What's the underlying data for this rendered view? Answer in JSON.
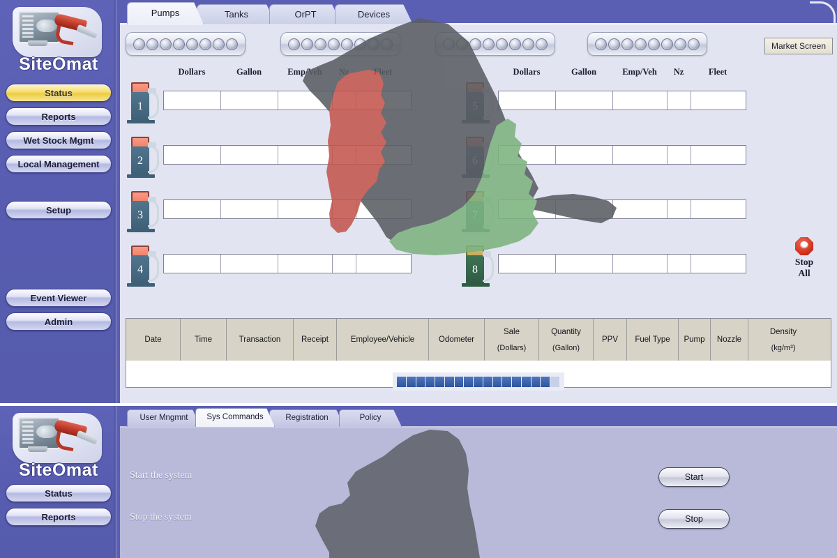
{
  "app": {
    "brand": "SiteOmat"
  },
  "top_panel": {
    "tabs": [
      {
        "label": "Pumps",
        "active": true
      },
      {
        "label": "Tanks",
        "active": false
      },
      {
        "label": "OrPT",
        "active": false
      },
      {
        "label": "Devices",
        "active": false
      }
    ],
    "indicator_groups": 4,
    "dots_per_group": 8,
    "market_screen_button": "Market Screen",
    "stop_all": {
      "line1": "Stop",
      "line2": "All",
      "icon": "stop-octagon-icon",
      "color": "#d0311c"
    },
    "pump_column_headers": [
      "Dollars",
      "Gallon",
      "Emp/Veh",
      "Nz",
      "Fleet"
    ],
    "pumps_left": [
      {
        "number": "1",
        "state": "normal"
      },
      {
        "number": "2",
        "state": "normal"
      },
      {
        "number": "3",
        "state": "normal"
      },
      {
        "number": "4",
        "state": "normal"
      }
    ],
    "pumps_right": [
      {
        "number": "5",
        "state": "normal"
      },
      {
        "number": "6",
        "state": "normal"
      },
      {
        "number": "7",
        "state": "normal"
      },
      {
        "number": "8",
        "state": "green"
      }
    ],
    "pump_field_values": {
      "dollars": "",
      "gallon": "",
      "emp_veh": "",
      "nz": "",
      "fleet": ""
    },
    "transactions_table": {
      "columns": [
        {
          "main": "Date",
          "sub": "",
          "width": 78
        },
        {
          "main": "Time",
          "sub": "",
          "width": 66
        },
        {
          "main": "Transaction",
          "sub": "",
          "width": 96
        },
        {
          "main": "Receipt",
          "sub": "",
          "width": 62
        },
        {
          "main": "Employee/Vehicle",
          "sub": "",
          "width": 132
        },
        {
          "main": "Odometer",
          "sub": "",
          "width": 80
        },
        {
          "main": "Sale",
          "sub": "(Dollars)",
          "width": 78
        },
        {
          "main": "Quantity",
          "sub": "(Gallon)",
          "width": 78
        },
        {
          "main": "PPV",
          "sub": "",
          "width": 48
        },
        {
          "main": "Fuel Type",
          "sub": "",
          "width": 74
        },
        {
          "main": "Pump",
          "sub": "",
          "width": 46
        },
        {
          "main": "Nozzle",
          "sub": "",
          "width": 54
        },
        {
          "main": "Density",
          "sub": "(kg/m³)",
          "width": 100
        }
      ],
      "rows": []
    },
    "progress": {
      "segments": 17,
      "filled": 16
    }
  },
  "sidebar": {
    "items": [
      {
        "label": "Status",
        "active": true
      },
      {
        "label": "Reports",
        "active": false
      },
      {
        "label": "Wet Stock Mgmt",
        "active": false
      },
      {
        "label": "Local Management",
        "active": false
      },
      {
        "label": "Setup",
        "active": false
      },
      {
        "label": "Event Viewer",
        "active": false
      },
      {
        "label": "Admin",
        "active": false
      }
    ]
  },
  "bottom_panel": {
    "tabs": [
      {
        "label": "User Mngmnt",
        "active": false
      },
      {
        "label": "Sys Commands",
        "active": true
      },
      {
        "label": "Registration",
        "active": false
      },
      {
        "label": "Policy",
        "active": false
      }
    ],
    "commands": [
      {
        "label": "Start the system",
        "button": "Start"
      },
      {
        "label": "Stop the system",
        "button": "Stop"
      }
    ],
    "sidebar_items": [
      {
        "label": "Status",
        "active": false
      },
      {
        "label": "Reports",
        "active": false
      }
    ]
  },
  "colors": {
    "sidebar": "#5a5fb4",
    "content_bg": "#e2e4f2",
    "bottom_content_bg": "#b9bada",
    "active_nav": "#f0d75a",
    "map_gray": "#5a5d63",
    "map_red": "#c4564e",
    "map_green": "#7cb37f",
    "pump_body": "#45687f",
    "pump_screen": "#f28d76"
  }
}
